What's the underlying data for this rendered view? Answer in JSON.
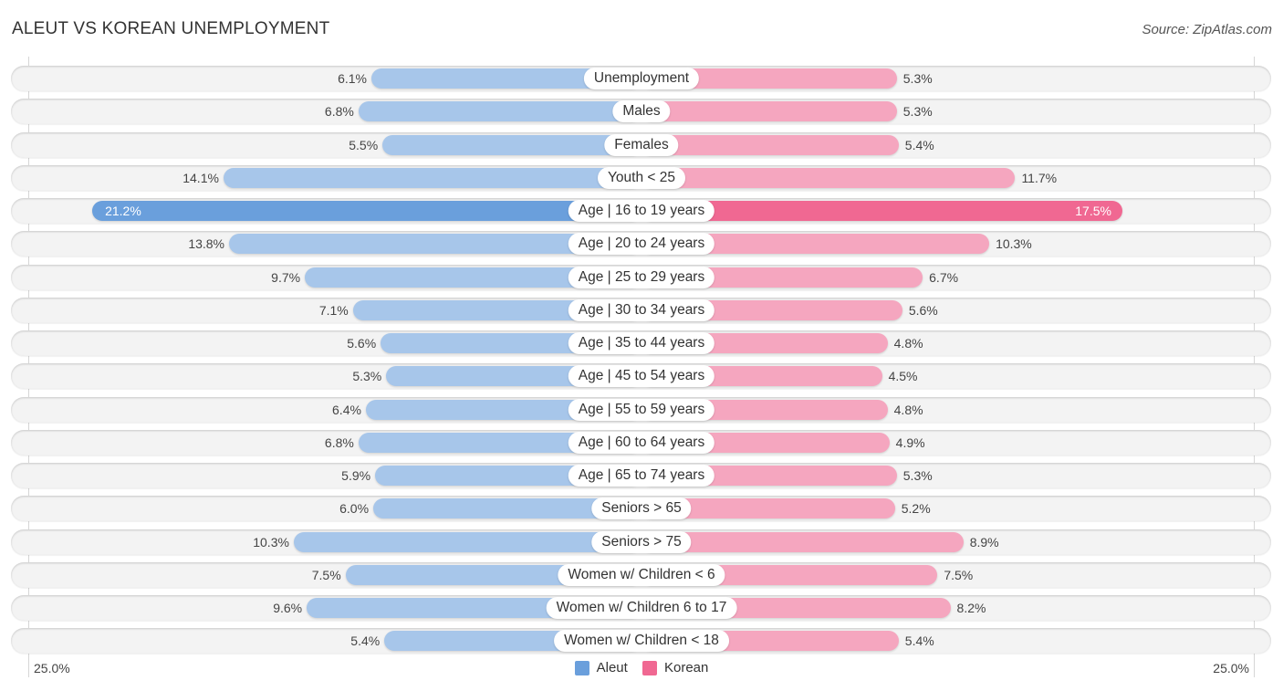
{
  "header": {
    "title": "ALEUT VS KOREAN UNEMPLOYMENT",
    "source": "Source: ZipAtlas.com"
  },
  "colors": {
    "aleut": "#a7c6ea",
    "aleut_strong": "#6a9fdc",
    "korean": "#f5a6bf",
    "korean_strong": "#f06892"
  },
  "chart_data": {
    "type": "bar",
    "orientation": "horizontal-diverging",
    "title": "ALEUT VS KOREAN UNEMPLOYMENT",
    "xlabel": "",
    "ylabel": "",
    "xlim": [
      0,
      25.0
    ],
    "axis_ticks": {
      "left": "25.0%",
      "right": "25.0%"
    },
    "legend": {
      "position": "bottom-center",
      "entries": [
        "Aleut",
        "Korean"
      ]
    },
    "categories": [
      "Unemployment",
      "Males",
      "Females",
      "Youth < 25",
      "Age | 16 to 19 years",
      "Age | 20 to 24 years",
      "Age | 25 to 29 years",
      "Age | 30 to 34 years",
      "Age | 35 to 44 years",
      "Age | 45 to 54 years",
      "Age | 55 to 59 years",
      "Age | 60 to 64 years",
      "Age | 65 to 74 years",
      "Seniors > 65",
      "Seniors > 75",
      "Women w/ Children < 6",
      "Women w/ Children 6 to 17",
      "Women w/ Children < 18"
    ],
    "series": [
      {
        "name": "Aleut",
        "side": "left",
        "values": [
          6.1,
          6.8,
          5.5,
          14.1,
          21.2,
          13.8,
          9.7,
          7.1,
          5.6,
          5.3,
          6.4,
          6.8,
          5.9,
          6.0,
          10.3,
          7.5,
          9.6,
          5.4
        ],
        "labels": [
          "6.1%",
          "6.8%",
          "5.5%",
          "14.1%",
          "21.2%",
          "13.8%",
          "9.7%",
          "7.1%",
          "5.6%",
          "5.3%",
          "6.4%",
          "6.8%",
          "5.9%",
          "6.0%",
          "10.3%",
          "7.5%",
          "9.6%",
          "5.4%"
        ]
      },
      {
        "name": "Korean",
        "side": "right",
        "values": [
          5.3,
          5.3,
          5.4,
          11.7,
          17.5,
          10.3,
          6.7,
          5.6,
          4.8,
          4.5,
          4.8,
          4.9,
          5.3,
          5.2,
          8.9,
          7.5,
          8.2,
          5.4
        ],
        "labels": [
          "5.3%",
          "5.3%",
          "5.4%",
          "11.7%",
          "17.5%",
          "10.3%",
          "6.7%",
          "5.6%",
          "4.8%",
          "4.5%",
          "4.8%",
          "4.9%",
          "5.3%",
          "5.2%",
          "8.9%",
          "7.5%",
          "8.2%",
          "5.4%"
        ]
      }
    ],
    "grid": false
  }
}
